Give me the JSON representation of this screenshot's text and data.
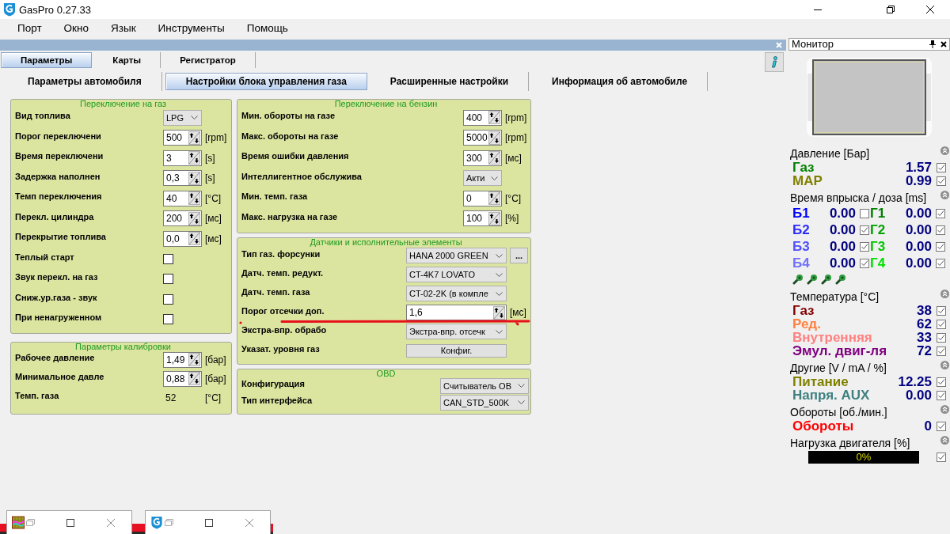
{
  "window": {
    "title": "GasPro 0.27.33"
  },
  "menu": [
    "Порт",
    "Окно",
    "Язык",
    "Инструменты",
    "Помощь"
  ],
  "tabs": [
    {
      "label": "Параметры",
      "selected": true
    },
    {
      "label": "Карты",
      "selected": false
    },
    {
      "label": "Регистратор",
      "selected": false
    }
  ],
  "subtabs": [
    {
      "label": "Параметры автомобиля",
      "selected": false
    },
    {
      "label": "Настройки блока управления газа",
      "selected": true
    },
    {
      "label": "Расширенные настройки",
      "selected": false
    },
    {
      "label": "Информация об автомобиле",
      "selected": false
    }
  ],
  "columns": [
    {
      "groups": [
        {
          "title": "Переключение на газ",
          "rows": [
            {
              "kind": "select",
              "label": "Вид топлива",
              "value": "LPG"
            },
            {
              "kind": "spin",
              "label": "Порог переключени",
              "value": "500",
              "unit": "[rpm]"
            },
            {
              "kind": "spin",
              "label": "Время переключени",
              "value": "3",
              "unit": "[s]"
            },
            {
              "kind": "spin",
              "label": "Задержка наполнен",
              "value": "0,3",
              "unit": "[s]"
            },
            {
              "kind": "spin",
              "label": "Темп переключения",
              "value": "40",
              "unit": "[°C]"
            },
            {
              "kind": "spin",
              "label": "Перекл. цилиндра",
              "value": "200",
              "unit": "[мс]"
            },
            {
              "kind": "spin",
              "label": "Перекрытие топлива",
              "value": "0,0",
              "unit": "[мс]"
            },
            {
              "kind": "check",
              "label": "Теплый старт",
              "checked": false
            },
            {
              "kind": "check",
              "label": "Звук перекл. на газ",
              "checked": false
            },
            {
              "kind": "check",
              "label": "Сниж.ур.газа - звук",
              "checked": false
            },
            {
              "kind": "check",
              "label": "При ненагруженном",
              "checked": false
            }
          ]
        },
        {
          "title": "Параметры калибровки",
          "rows": [
            {
              "kind": "spin",
              "label": "Рабочее давление",
              "value": "1,49",
              "unit": "[бар]"
            },
            {
              "kind": "spin",
              "label": "Минимальное давле",
              "value": "0,88",
              "unit": "[бар]"
            },
            {
              "kind": "text",
              "label": "Темп. газа",
              "value": "52",
              "unit": "[°C]"
            }
          ]
        }
      ]
    },
    {
      "groups": [
        {
          "title": "Переключение на бензин",
          "rows": [
            {
              "kind": "spin",
              "label": "Мин. обороты на газе",
              "value": "400",
              "unit": "[rpm]"
            },
            {
              "kind": "spin",
              "label": "Макс. обороты на газе",
              "value": "5000",
              "unit": "[rpm]"
            },
            {
              "kind": "spin",
              "label": "Время ошибки давления",
              "value": "300",
              "unit": "[мс]"
            },
            {
              "kind": "select",
              "label": "Интеллигентное обслужива",
              "value": "Акти"
            },
            {
              "kind": "spin",
              "label": "Мин. темп. газа",
              "value": "0",
              "unit": "[°C]"
            },
            {
              "kind": "spin",
              "label": "Макс. нагрузка на газе",
              "value": "100",
              "unit": "[%]"
            }
          ]
        },
        {
          "title": "Датчики и исполнительные элементы",
          "rows": [
            {
              "kind": "select",
              "label": "Тип газ. форсунки",
              "value": "HANA 2000 GREEN",
              "extra": "..."
            },
            {
              "kind": "select",
              "label": "Датч. темп. редукт.",
              "value": "CT-4K7 LOVATO"
            },
            {
              "kind": "select",
              "label": "Датч. темп. газа",
              "value": "CT-02-2K (в компле"
            },
            {
              "kind": "spin",
              "label": "Порог отсечки доп.",
              "value": "1,6",
              "unit": "[мс]"
            },
            {
              "kind": "select",
              "label": "Экстра-впр. обрабо",
              "value": "Экстра-впр. отсечк"
            },
            {
              "kind": "button",
              "label": "Указат. уровня газ",
              "value": "Конфиг."
            }
          ]
        },
        {
          "title": "OBD",
          "rows": [
            {
              "kind": "select",
              "label": "Конфигурация",
              "value": "Считыватель OB"
            },
            {
              "kind": "select",
              "label": "Тип интерфейса",
              "value": "CAN_STD_500K"
            }
          ]
        }
      ]
    }
  ],
  "monitor": {
    "title": "Монитор",
    "sections": [
      {
        "kind": "values",
        "title": "Давление [Бар]",
        "rows": [
          {
            "label": "Газ",
            "value": "1.57",
            "color": "#008000",
            "checked": true
          },
          {
            "label": "MAP",
            "value": "0.99",
            "color": "#808000",
            "checked": true
          }
        ]
      },
      {
        "kind": "injection",
        "title": "Время впрыска / доза [ms]",
        "rows": [
          {
            "cells": [
              {
                "label": "Б1",
                "value": "0.00",
                "color": "#0000ff",
                "checked": false
              },
              {
                "label": "Г1",
                "value": "0.00",
                "color": "#008000",
                "checked": true
              }
            ]
          },
          {
            "cells": [
              {
                "label": "Б2",
                "value": "0.00",
                "color": "#2b2bff",
                "checked": true
              },
              {
                "label": "Г2",
                "value": "0.00",
                "color": "#00a000",
                "checked": true
              }
            ]
          },
          {
            "cells": [
              {
                "label": "Б3",
                "value": "0.00",
                "color": "#5050ff",
                "checked": true
              },
              {
                "label": "Г3",
                "value": "0.00",
                "color": "#00c800",
                "checked": true
              }
            ]
          },
          {
            "cells": [
              {
                "label": "Б4",
                "value": "0.00",
                "color": "#7070ff",
                "checked": true
              },
              {
                "label": "Г4",
                "value": "0.00",
                "color": "#00e000",
                "checked": true
              }
            ]
          }
        ]
      },
      {
        "kind": "values",
        "title": "Температура [°C]",
        "rows": [
          {
            "label": "Газ",
            "value": "38",
            "color": "#800000",
            "checked": true
          },
          {
            "label": "Ред.",
            "value": "62",
            "color": "#ff8040",
            "checked": true
          },
          {
            "label": "Внутренняя",
            "value": "33",
            "color": "#ff8080",
            "checked": true
          },
          {
            "label": "Эмул. двиг-ля",
            "value": "72",
            "color": "#800080",
            "checked": true
          }
        ]
      },
      {
        "kind": "values",
        "title": "Другие [V / mA / %]",
        "rows": [
          {
            "label": "Питание",
            "value": "12.25",
            "color": "#808000",
            "checked": true
          },
          {
            "label": "Напря. AUX",
            "value": "0.00",
            "color": "#408080",
            "checked": true
          }
        ]
      },
      {
        "kind": "values",
        "title": "Обороты [об./мин.]",
        "rows": [
          {
            "label": "Обороты",
            "value": "0",
            "color": "#ff0000",
            "checked": true
          }
        ]
      },
      {
        "kind": "bar",
        "title": "Нагрузка двигателя [%]",
        "level": 0,
        "reading": "0%",
        "checked": true
      }
    ]
  },
  "minimized_windows": [
    {
      "kind": "graph"
    },
    {
      "kind": "app"
    }
  ]
}
